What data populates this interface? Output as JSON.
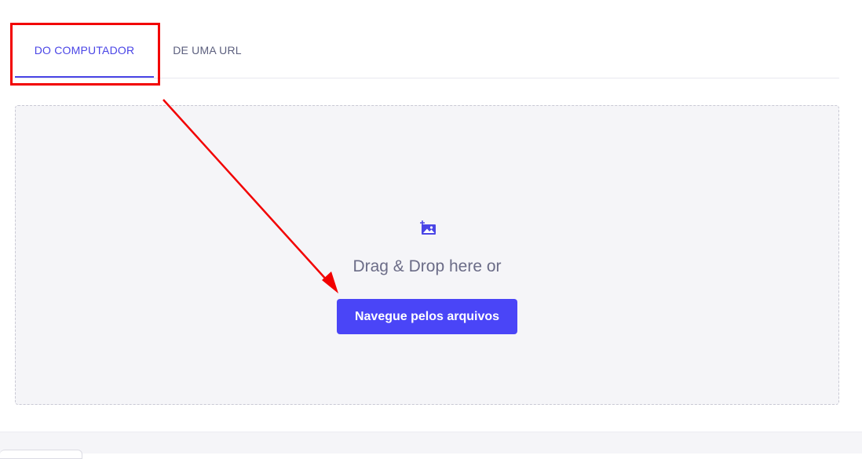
{
  "tabs": [
    {
      "label": "DO COMPUTADOR",
      "active": true
    },
    {
      "label": "DE UMA URL",
      "active": false
    }
  ],
  "dropzone": {
    "icon": "image-upload-icon",
    "prompt": "Drag & Drop here or",
    "button_label": "Navegue pelos arquivos"
  },
  "colors": {
    "accent": "#4a45f7",
    "annotation": "#f20000",
    "dropzone_bg": "#f5f5f8",
    "muted_text": "#6b6c87"
  }
}
